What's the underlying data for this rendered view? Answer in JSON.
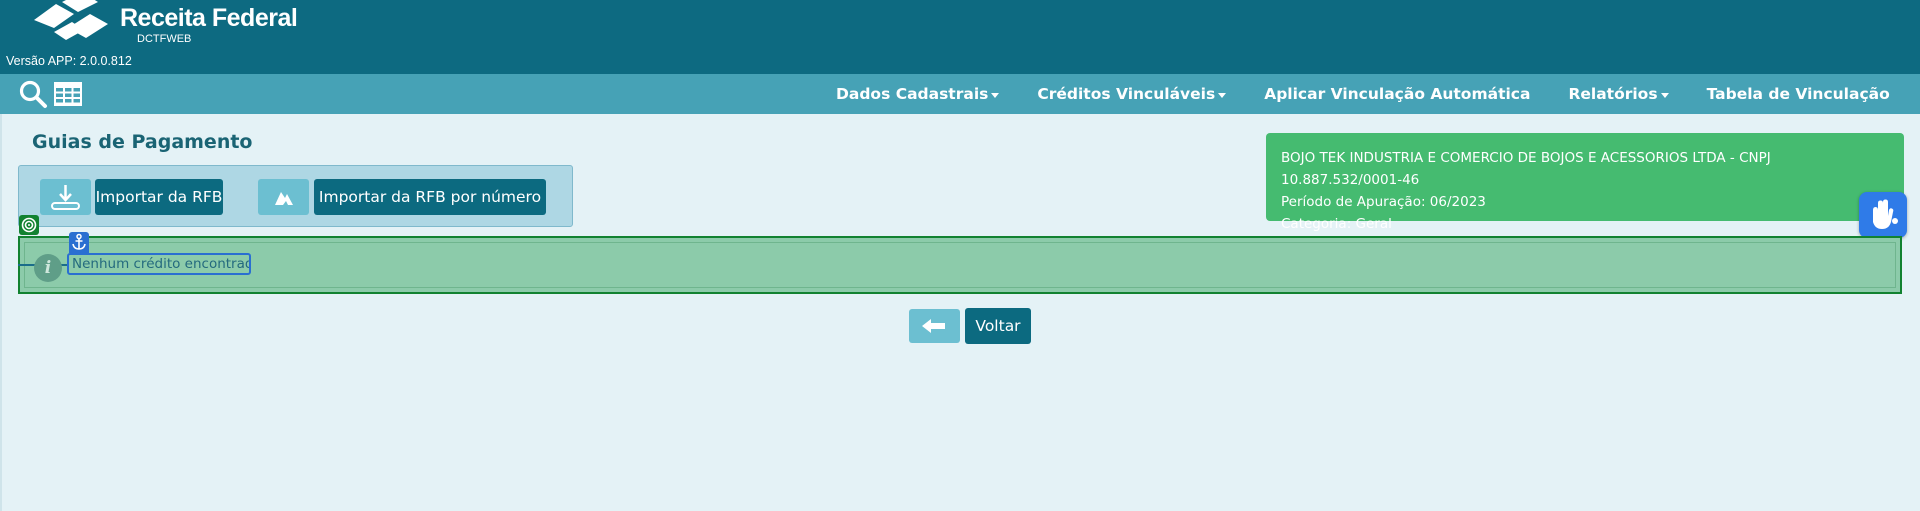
{
  "header": {
    "logo_title": "Receita Federal",
    "logo_subtitle": "DCTFWEB",
    "version": "Versão APP: 2.0.0.812",
    "background": "#0d6a81"
  },
  "nav": {
    "background": "#46a2b6",
    "icons": [
      "search-icon",
      "table-icon"
    ],
    "items": [
      {
        "label": "Dados Cadastrais",
        "dropdown": true
      },
      {
        "label": "Créditos Vinculáveis",
        "dropdown": true
      },
      {
        "label": "Aplicar Vinculação Automática",
        "dropdown": false
      },
      {
        "label": "Relatórios",
        "dropdown": true
      },
      {
        "label": "Tabela de Vinculação",
        "dropdown": false
      }
    ]
  },
  "page": {
    "title": "Guias de Pagamento"
  },
  "actions": {
    "import_rfb": "Importar da RFB",
    "import_rfb_number": "Importar da RFB por número",
    "back": "Voltar"
  },
  "company_info": {
    "name_line": "BOJO TEK INDUSTRIA E COMERCIO DE BOJOS E ACESSORIOS LTDA - CNPJ 10.887.532/0001-46",
    "period_line": "Período de Apuração: 06/2023",
    "category_line": "Categoria: Geral",
    "background": "#45bb70"
  },
  "alert": {
    "icon": "info-icon",
    "message": "Nenhum crédito encontrado"
  },
  "accessibility": {
    "icon": "sign-language-icon"
  }
}
